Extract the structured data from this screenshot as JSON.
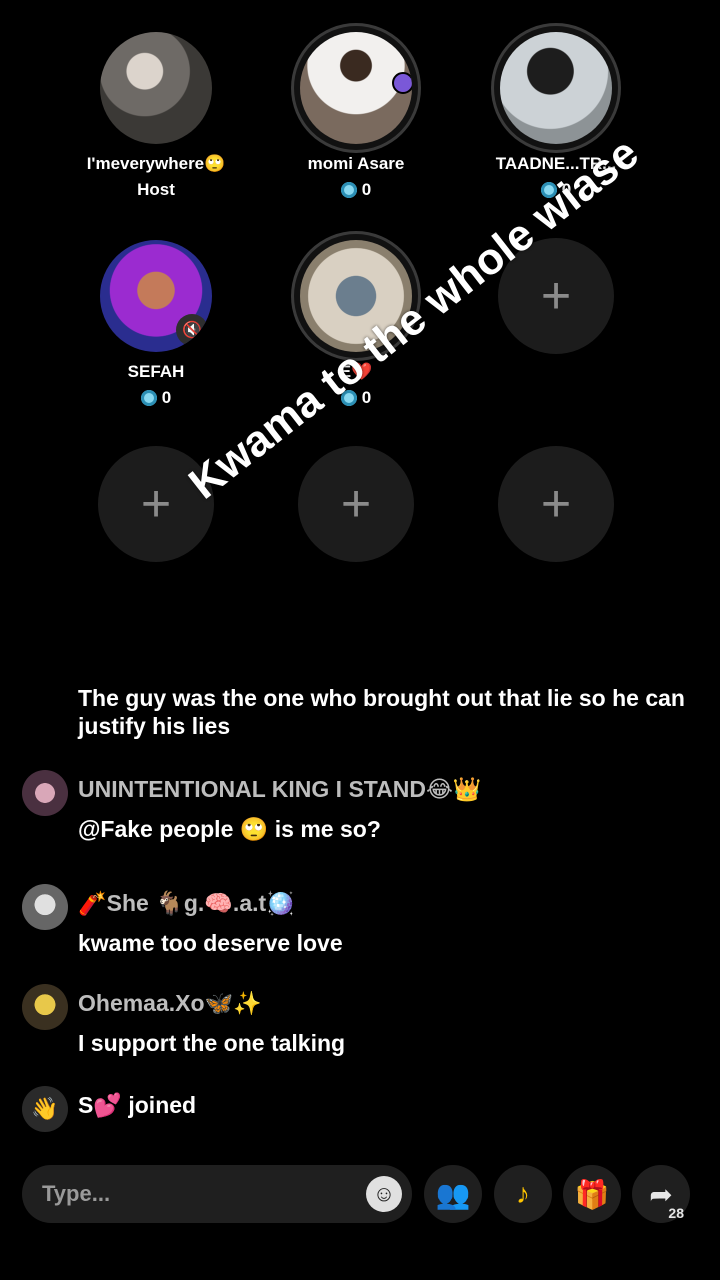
{
  "overlay_text": "Kwama to the whole wiase",
  "seats": [
    {
      "name": "I'meverywhere🙄",
      "sub": "Host"
    },
    {
      "name": "momi Asare",
      "coins": "0"
    },
    {
      "name": "TAADNE...TR...",
      "coins": "0"
    },
    {
      "name": "SEFAH",
      "coins": "0"
    },
    {
      "name": "E❤️",
      "coins": "0"
    }
  ],
  "chat": {
    "partial_text": "The guy was the one who brought out that lie so he can justify his lies",
    "messages": [
      {
        "user": "UNINTENTIONAL KING I STAND😂👑",
        "text": "@Fake people 🙄 is me so?"
      },
      {
        "user": "🧨She 🐐g.🧠.a.t🪩",
        "text": "kwame too deserve love"
      },
      {
        "user": "Ohemaa.Xo🦋✨",
        "text": "I support the one talking"
      }
    ],
    "join_event": "S💕 joined"
  },
  "composer": {
    "placeholder": "Type...",
    "share_count": "28"
  },
  "icons": {
    "add": "+",
    "emoji": "☺",
    "people": "👥",
    "tiktok": "♪",
    "gift": "🎁",
    "share": "➦",
    "wave": "👋",
    "mute": "🔇"
  }
}
